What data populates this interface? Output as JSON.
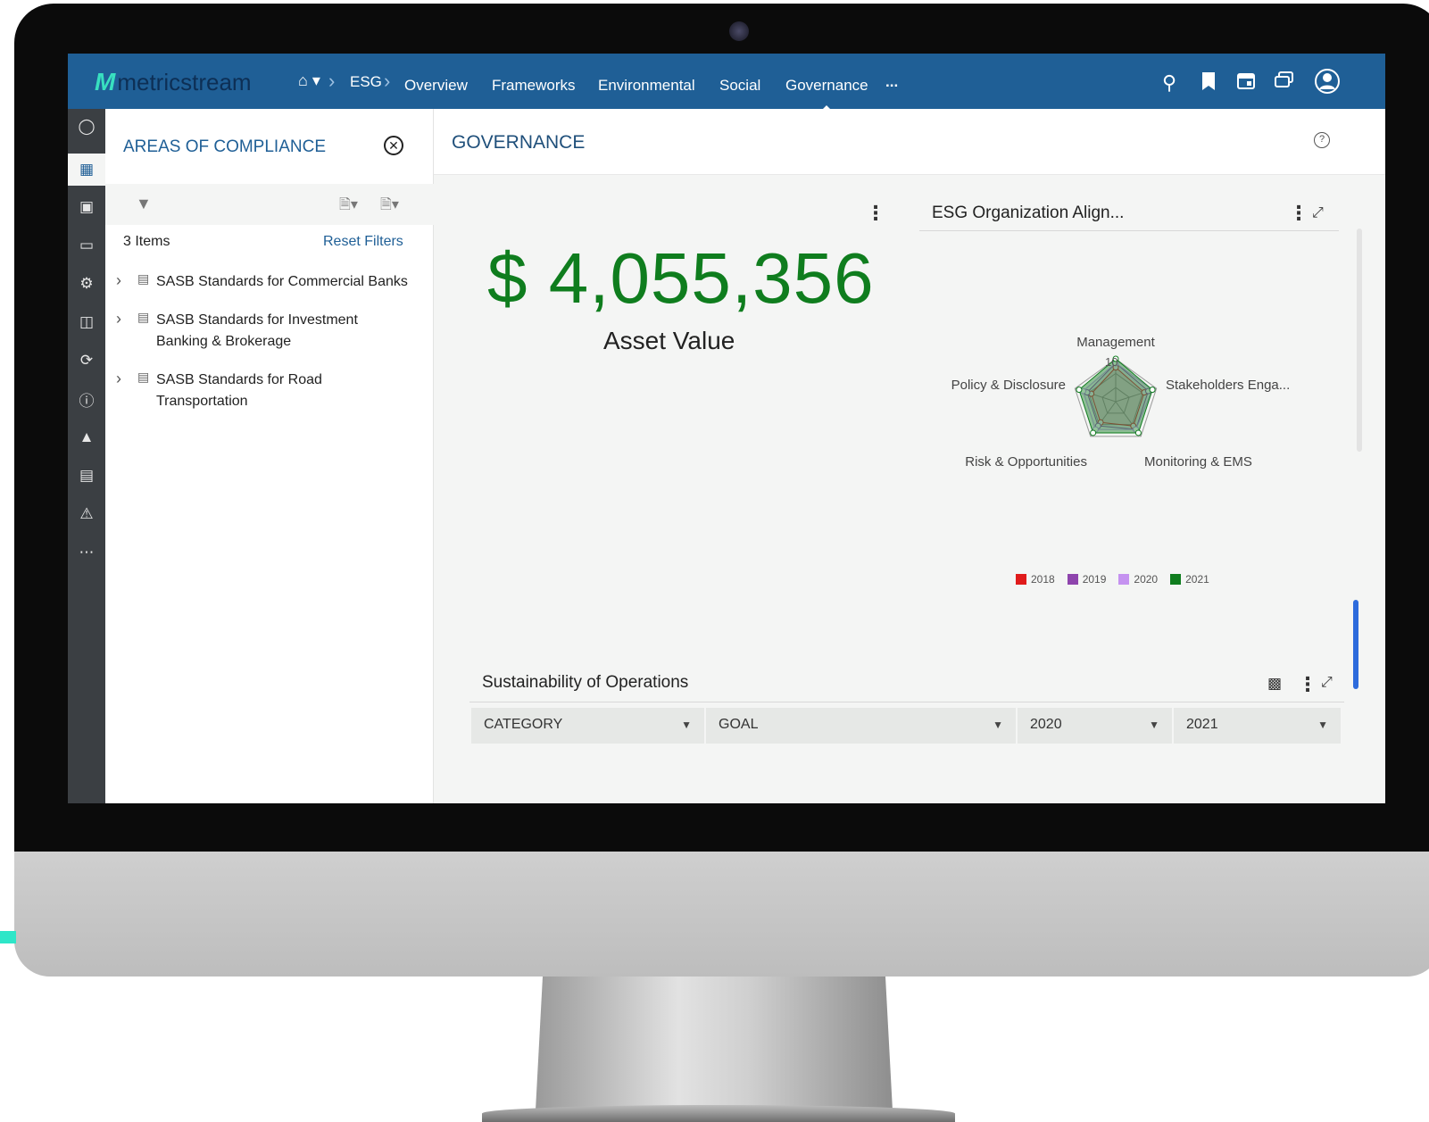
{
  "brand": {
    "name": "metricstream",
    "accent": "#38e0c0",
    "bar_color": "#1f5f96"
  },
  "breadcrumb": [
    "ESG"
  ],
  "nav": {
    "items": [
      "Overview",
      "Frameworks",
      "Environmental",
      "Social",
      "Governance",
      "..."
    ],
    "active": "Governance"
  },
  "top_icons": [
    "search-icon",
    "bookmark-icon",
    "calendar-icon",
    "messages-icon",
    "user-icon"
  ],
  "rail_icons": [
    "dashboard-icon",
    "compliance-icon",
    "review-icon",
    "monitor-icon",
    "settings-icon",
    "documents-icon",
    "cycle-icon",
    "help-icon",
    "upload-icon",
    "report-icon",
    "warning-icon",
    "more-icon"
  ],
  "panel": {
    "title": "AREAS OF COMPLIANCE",
    "items_count": "3 Items",
    "reset_filters": "Reset Filters",
    "tree": [
      {
        "line1": "SASB Standards for Commercial Banks",
        "line2": ""
      },
      {
        "line1": "SASB Standards for Investment",
        "line2": "Banking & Brokerage"
      },
      {
        "line1": "SASB Standards for Road",
        "line2": "Transportation"
      }
    ]
  },
  "main": {
    "title": "GOVERNANCE",
    "asset_value": "$ 4,055,356",
    "asset_label": "Asset Value",
    "chart_title": "ESG Organization Align...",
    "sustainability_title": "Sustainability of Operations",
    "columns": [
      "CATEGORY",
      "GOAL",
      "2020",
      "2021"
    ]
  },
  "chart_data": {
    "type": "radar",
    "title": "ESG Organization Align...",
    "axes": [
      "Management",
      "Stakeholders Enga...",
      "Monitoring & EMS",
      "Risk & Opportunities",
      "Policy & Disclosure"
    ],
    "max": 10,
    "scale_label": "10",
    "legend_placement": "bottom",
    "series": [
      {
        "name": "2018",
        "color": "#e01b1b",
        "values": [
          8,
          7,
          7,
          6,
          6
        ]
      },
      {
        "name": "2019",
        "color": "#8e44ad",
        "values": [
          9,
          8,
          8,
          7,
          7
        ]
      },
      {
        "name": "2020",
        "color": "#c592f0",
        "values": [
          9,
          9,
          8,
          8,
          8
        ]
      },
      {
        "name": "2021",
        "color": "#0f7d1e",
        "values": [
          10,
          9,
          9,
          9,
          9
        ]
      }
    ]
  }
}
